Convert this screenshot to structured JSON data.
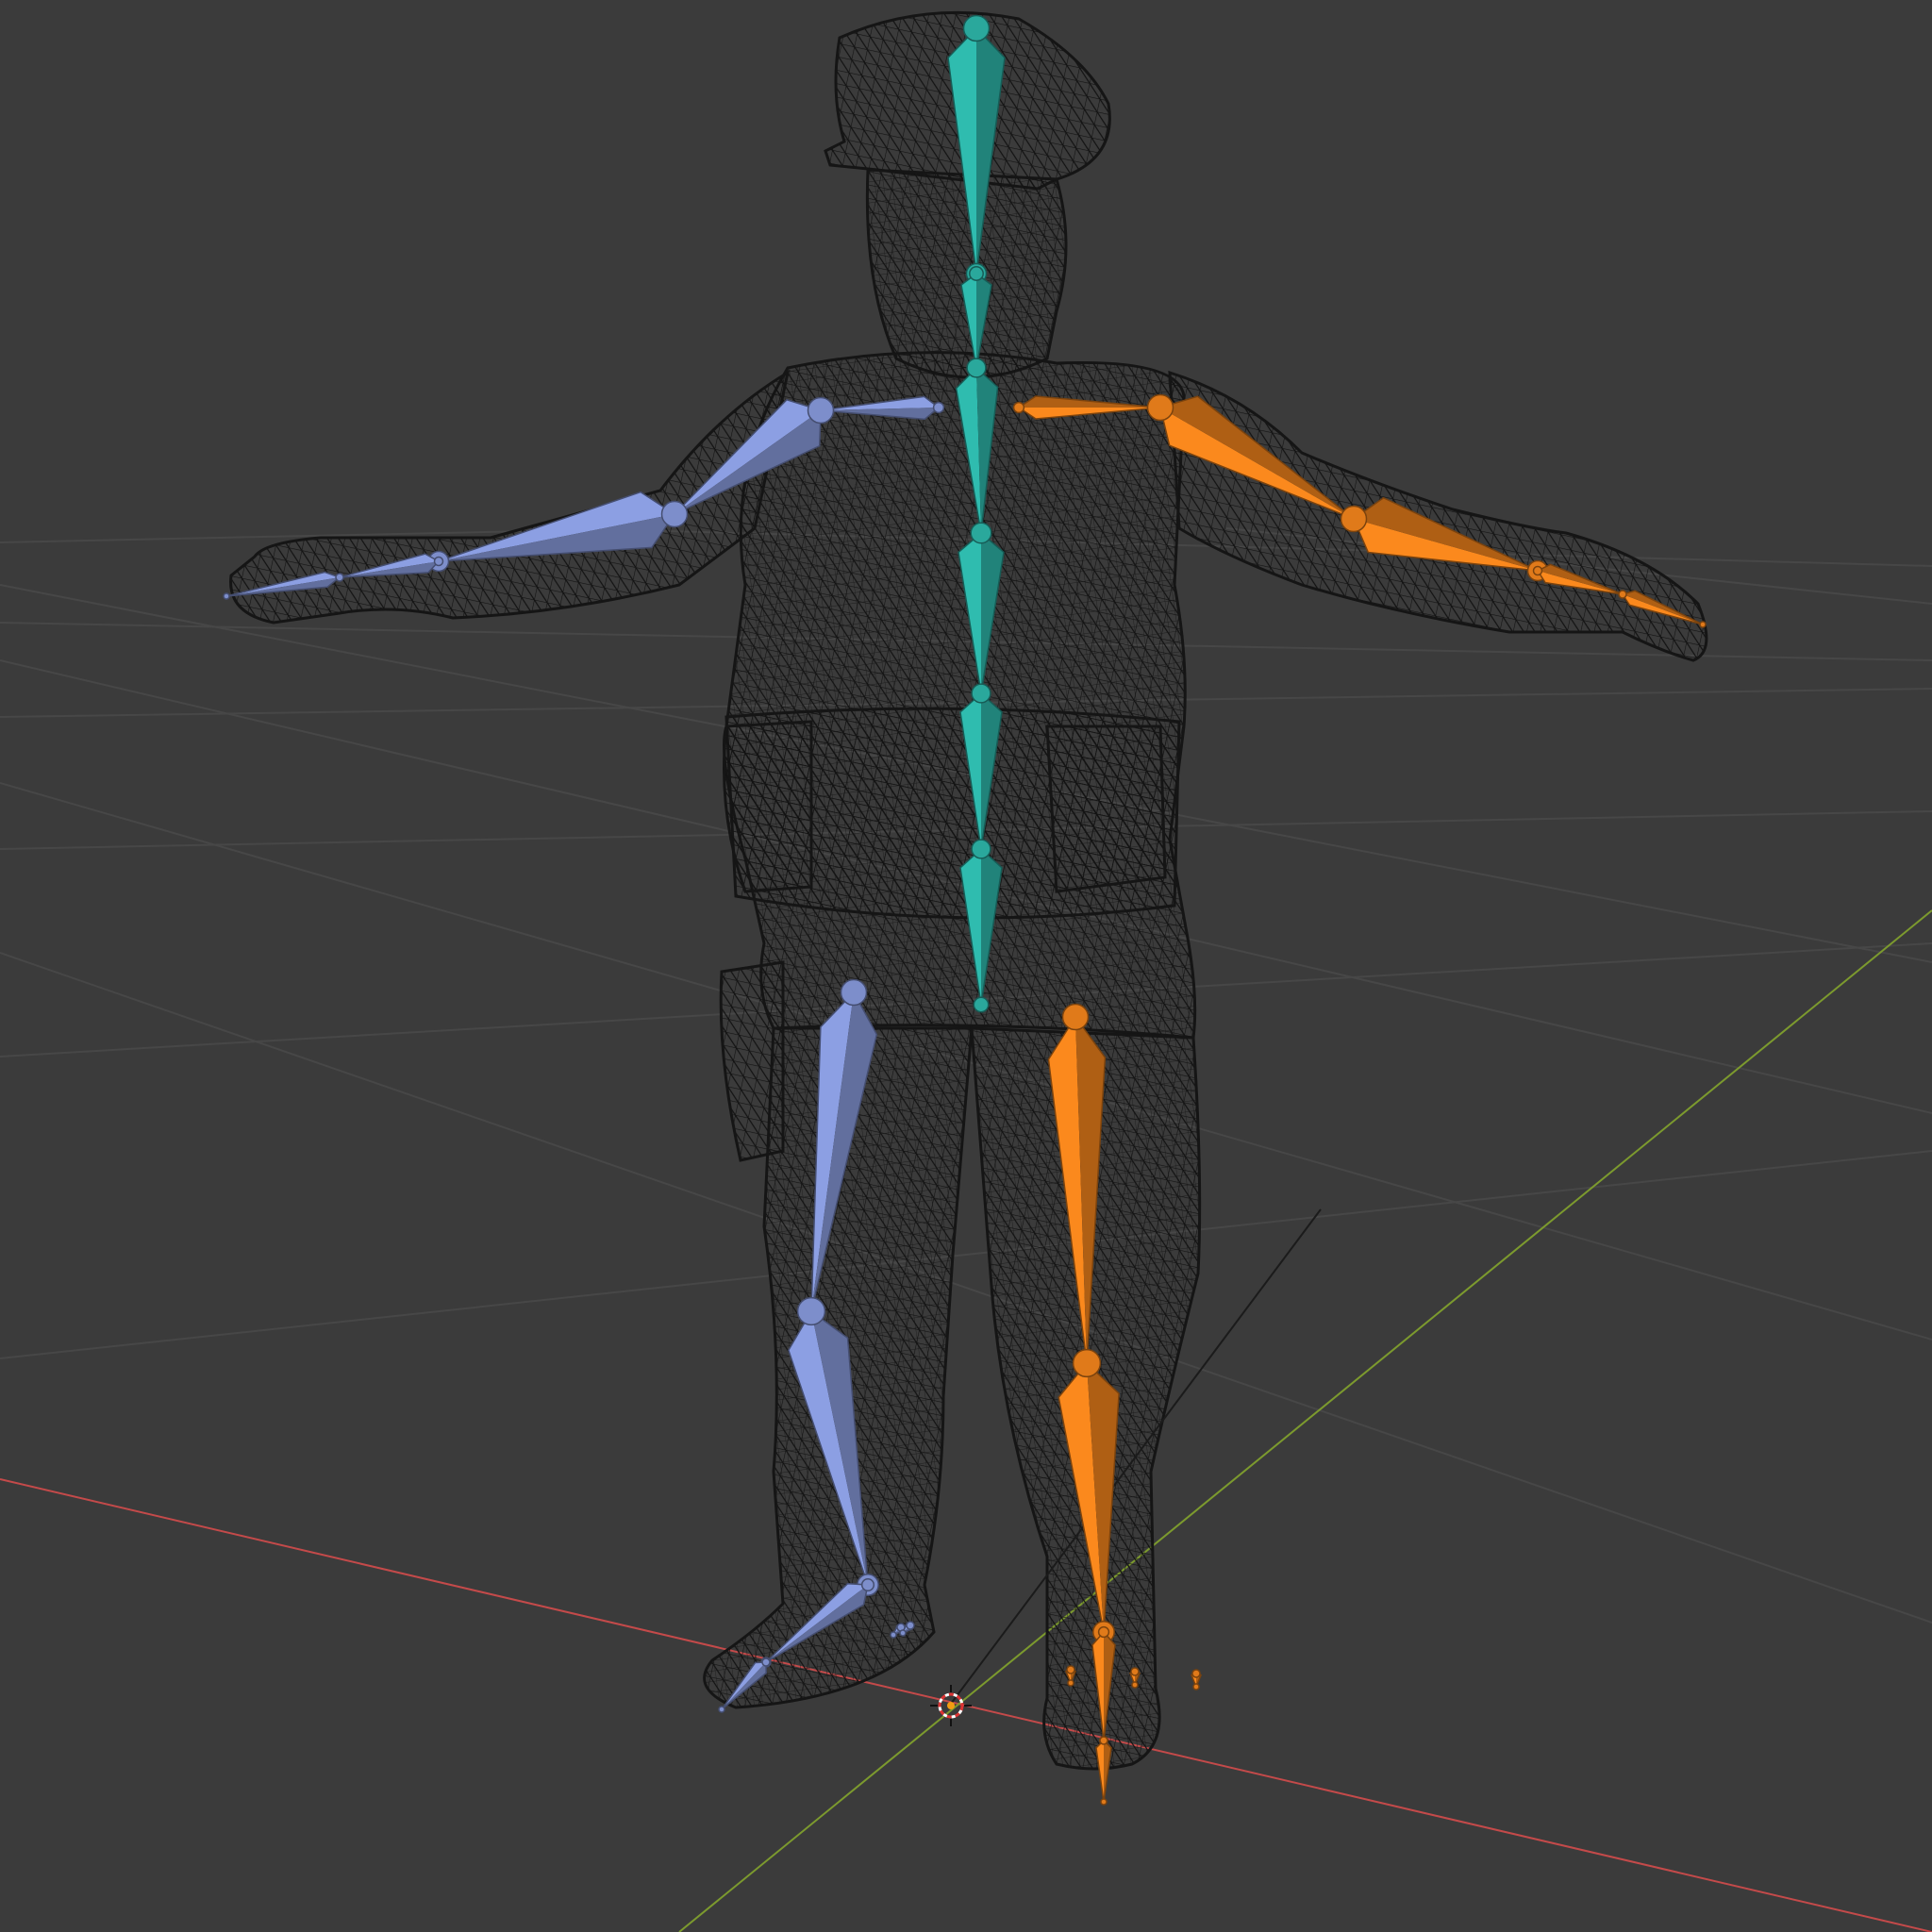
{
  "viewport": {
    "background": "#3b3b3b",
    "mode": "pose-wireframe",
    "grid_color": "#4b4b4b",
    "x_axis_color": "#c44a4a",
    "y_axis_color": "#7c9a2e"
  },
  "mesh": {
    "name": "soldier-character",
    "wire_color": "#141414"
  },
  "armature": {
    "colors": {
      "center": "#2aa89c",
      "left": "#7d8ecb",
      "right": "#e07a1a"
    },
    "groups": [
      "spine",
      "left-arm",
      "right-arm",
      "left-leg",
      "right-leg"
    ]
  },
  "gizmos": [
    "3d-cursor-icon",
    "origin-icon"
  ]
}
